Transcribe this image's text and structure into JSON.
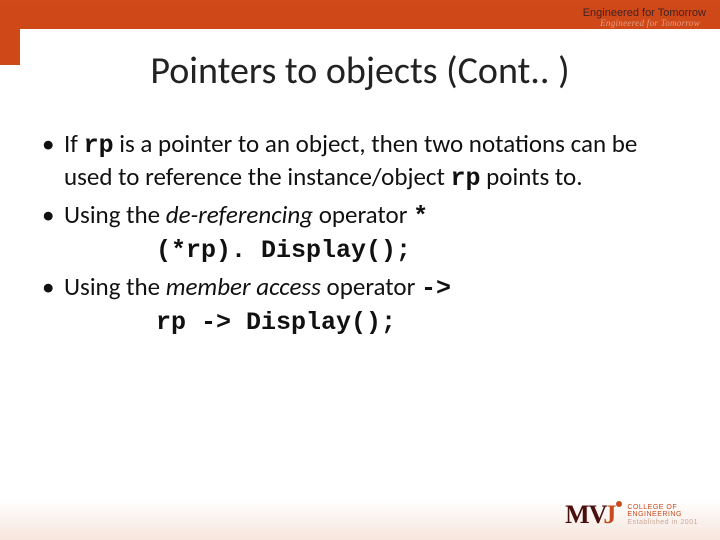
{
  "header": {
    "tagline": "Engineered for Tomorrow",
    "subtag": "Engineered for Tomorrow"
  },
  "title": "Pointers to objects (Cont.. )",
  "bullets": {
    "b1": {
      "p1": "If ",
      "code1": "rp",
      "p2": " is a pointer to an object, then two notations can be used to reference the instance/object ",
      "code2": "rp",
      "p3": " points to."
    },
    "b2": {
      "p1": "Using the ",
      "i1": "de-referencing",
      "p2": " operator ",
      "code1": "*"
    },
    "code_a": "(*rp). Display();",
    "b3": {
      "p1": "Using the ",
      "i1": "member access",
      "p2": " operator ",
      "code1": "->"
    },
    "code_b": "rp -> Display();"
  },
  "logo": {
    "l1": "COLLEGE  OF",
    "l2": "ENGINEERING",
    "l3": "Established in 2001"
  }
}
